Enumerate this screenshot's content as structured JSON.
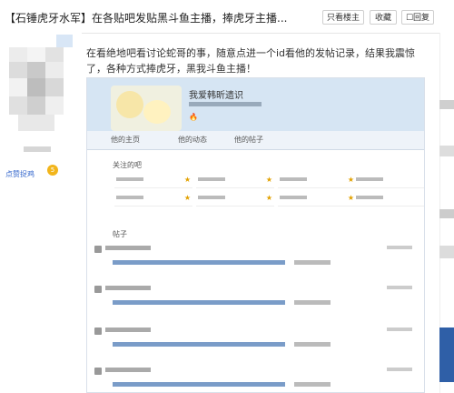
{
  "header": {
    "title": "【石锤虎牙水军】在各贴吧发贴黑斗鱼主播，捧虎牙主播...",
    "buttons": [
      "只看楼主",
      "收藏",
      "回复"
    ]
  },
  "post": {
    "author_level_label": "点赞捉鸡",
    "badge": "5",
    "text": "在看绝地吧看讨论蛇哥的事，随意点进一个id看他的发帖记录，结果我震惊了，各种方式捧虎牙，黑我斗鱼主播！"
  },
  "screenshot": {
    "profile_name": "我爱韩昕遗识",
    "tabs": [
      "他的主页",
      "他的动态",
      "他的帖子"
    ],
    "followed_label": "关注的吧",
    "posts_label": "帖子"
  },
  "colors": {
    "accent": "#3366cc",
    "header_bg": "#d6e5f3"
  }
}
